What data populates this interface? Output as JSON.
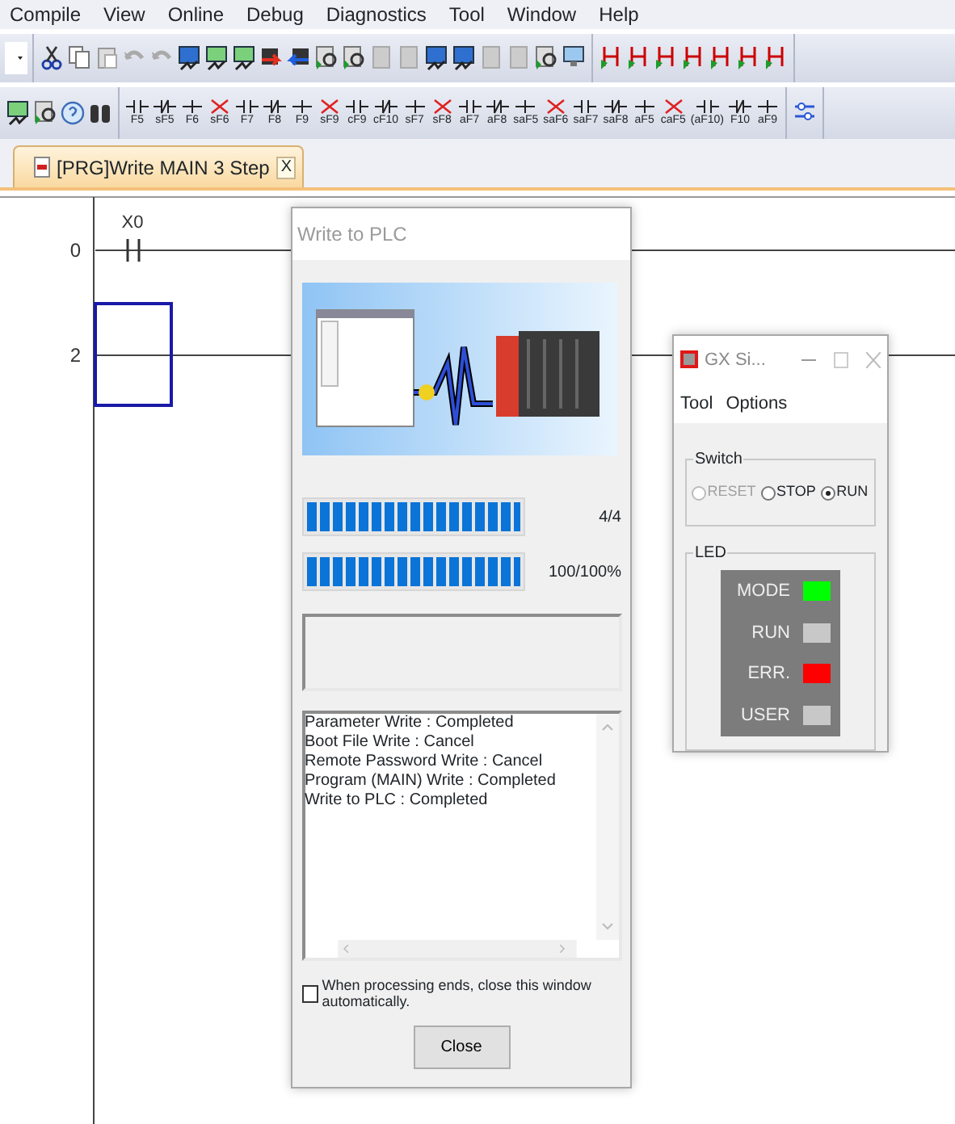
{
  "menu": [
    "Compile",
    "View",
    "Online",
    "Debug",
    "Diagnostics",
    "Tool",
    "Window",
    "Help"
  ],
  "function_keys": [
    "F5",
    "sF5",
    "F6",
    "sF6",
    "F7",
    "F8",
    "F9",
    "sF9",
    "cF9",
    "cF10",
    "sF7",
    "sF8",
    "aF7",
    "aF8",
    "saF5",
    "saF6",
    "saF7",
    "saF8",
    "aF5",
    "caF5",
    "(aF10)",
    "F10",
    "aF9"
  ],
  "tab": {
    "title": "[PRG]Write MAIN 3 Step",
    "close": "X",
    "selected": true
  },
  "ladder": {
    "rungs": [
      {
        "step": "0",
        "device": "X0"
      },
      {
        "step": "2"
      }
    ]
  },
  "write_dialog": {
    "title": "Write to PLC",
    "progress": [
      {
        "level": 1,
        "reading": "4/4"
      },
      {
        "level": 1,
        "reading": "100/100%"
      }
    ],
    "log": [
      "Parameter Write : Completed",
      "Boot File Write : Cancel",
      "Remote Password Write : Cancel",
      "Program (MAIN) Write : Completed",
      "Write to PLC : Completed"
    ],
    "auto_close": {
      "label": "When processing ends, close this window automatically.",
      "checked": false
    },
    "close_button": "Close"
  },
  "simulator": {
    "title": "GX Si...",
    "menu": [
      "Tool",
      "Options"
    ],
    "switch": {
      "title": "Switch",
      "options": [
        {
          "label": "RESET",
          "selected": false,
          "disabled": true
        },
        {
          "label": "STOP",
          "selected": false,
          "disabled": false
        },
        {
          "label": "RUN",
          "selected": true,
          "disabled": false
        }
      ]
    },
    "led": {
      "title": "LED",
      "lights": [
        {
          "label": "MODE",
          "color": "#00ff00"
        },
        {
          "label": "RUN",
          "color": "#c8c8c8"
        },
        {
          "label": "ERR.",
          "color": "#ff0000"
        },
        {
          "label": "USER",
          "color": "#c8c8c8"
        }
      ]
    }
  }
}
